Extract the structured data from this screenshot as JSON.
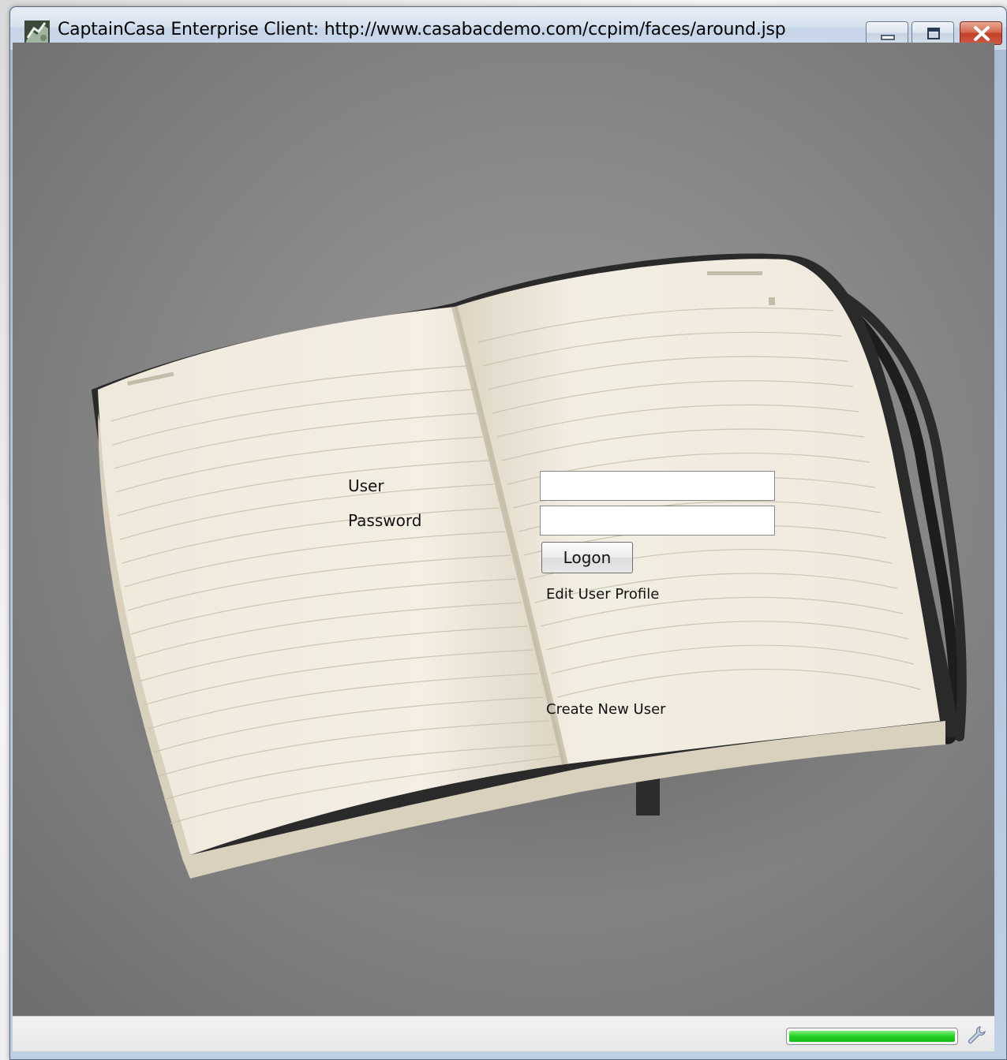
{
  "window": {
    "title": "CaptainCasa Enterprise Client: http://www.casabacdemo.com/ccpim/faces/around.jsp",
    "icon": "captaincasa-logo-icon",
    "controls": [
      "minimize-icon",
      "maximize-icon",
      "close-icon"
    ]
  },
  "login": {
    "user_label": "User",
    "password_label": "Password",
    "user_value": "",
    "password_value": "",
    "logon_button": "Logon",
    "edit_profile_link": "Edit User Profile",
    "create_user_link": "Create New User"
  },
  "statusbar": {
    "progress": 1.0,
    "progress_color": "#22d222",
    "settings_icon": "wrench-icon"
  }
}
